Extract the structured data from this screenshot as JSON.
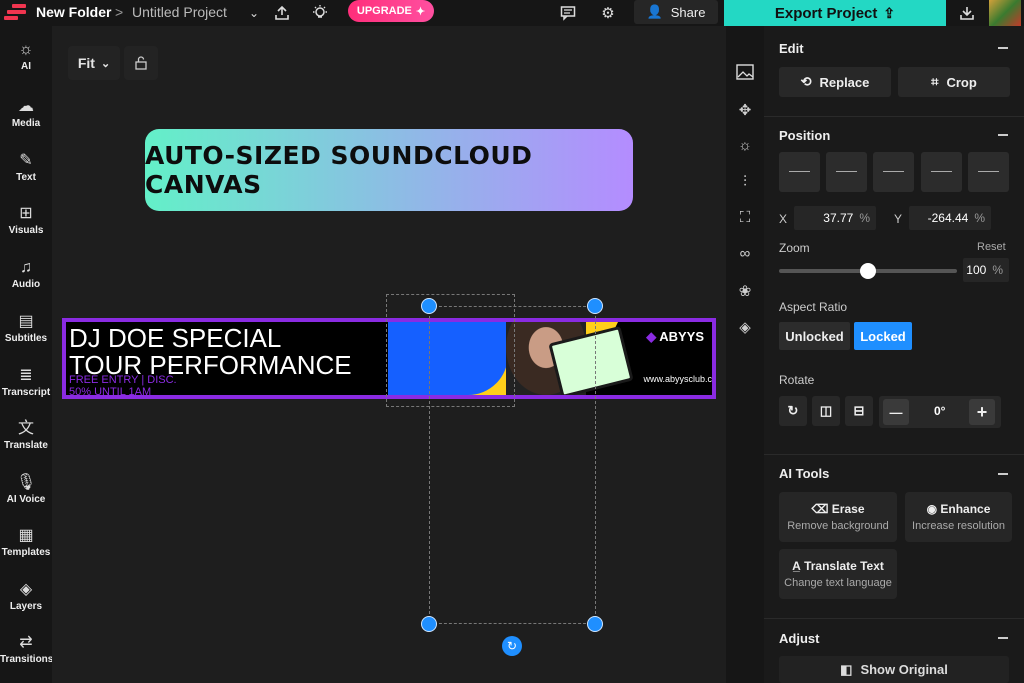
{
  "topbar": {
    "folder": "New Folder",
    "separator": ">",
    "project": "Untitled Project",
    "upgrade": "UPGRADE",
    "share": "Share",
    "export": "Export Project"
  },
  "leftbar": [
    {
      "label": "AI",
      "icon": "ai-bulb-icon"
    },
    {
      "label": "Media",
      "icon": "upload-cloud-icon"
    },
    {
      "label": "Text",
      "icon": "text-edit-icon"
    },
    {
      "label": "Visuals",
      "icon": "shapes-icon"
    },
    {
      "label": "Audio",
      "icon": "music-note-icon"
    },
    {
      "label": "Subtitles",
      "icon": "subtitles-icon"
    },
    {
      "label": "Transcript",
      "icon": "transcript-icon"
    },
    {
      "label": "Translate",
      "icon": "translate-icon"
    },
    {
      "label": "AI Voice",
      "icon": "microphone-icon"
    },
    {
      "label": "Templates",
      "icon": "templates-icon"
    },
    {
      "label": "Layers",
      "icon": "layers-icon"
    },
    {
      "label": "Transitions",
      "icon": "transitions-icon"
    }
  ],
  "canvas": {
    "fit": "Fit",
    "title_card": "AUTO-SIZED SOUNDCLOUD CANVAS",
    "banner": {
      "line1": "DJ DOE SPECIAL",
      "line2": "TOUR PERFORMANCE",
      "sub1": "FREE ENTRY | DISC.",
      "sub2": "50% UNTIL 1AM",
      "brand": "ABYYS",
      "url": "www.abyysclub.c"
    }
  },
  "panel": {
    "edit": {
      "title": "Edit",
      "replace": "Replace",
      "crop": "Crop"
    },
    "position": {
      "title": "Position",
      "x_label": "X",
      "x_value": "37.77",
      "y_label": "Y",
      "y_value": "-264.44",
      "unit": "%"
    },
    "zoom": {
      "title": "Zoom",
      "reset": "Reset",
      "value": "100",
      "unit": "%",
      "level": 0.5
    },
    "aspect": {
      "title": "Aspect Ratio",
      "unlocked": "Unlocked",
      "locked": "Locked"
    },
    "rotate": {
      "title": "Rotate",
      "minus": "—",
      "value": "0°",
      "plus": "+"
    },
    "ai_tools": {
      "title": "AI Tools",
      "erase": "Erase",
      "erase_sub": "Remove background",
      "enhance": "Enhance",
      "enhance_sub": "Increase resolution",
      "translate": "Translate Text",
      "translate_sub": "Change text language"
    },
    "adjust": {
      "title": "Adjust",
      "show_original": "Show Original"
    }
  },
  "colors": {
    "accent": "#23d8c4",
    "brand_red": "#f0354f",
    "selection": "#1f8fff",
    "banner_border": "#8a2be2"
  }
}
